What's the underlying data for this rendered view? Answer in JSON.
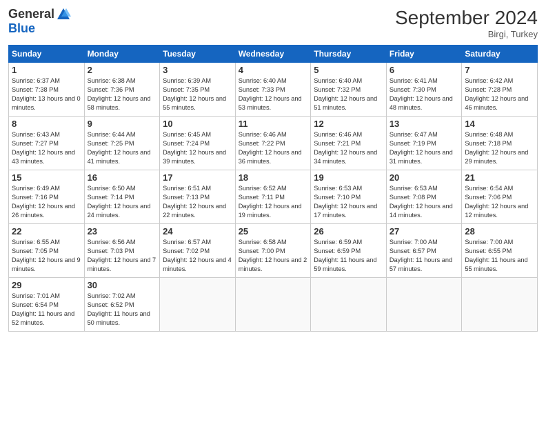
{
  "header": {
    "logo_line1": "General",
    "logo_line2": "Blue",
    "month": "September 2024",
    "location": "Birgi, Turkey"
  },
  "days_of_week": [
    "Sunday",
    "Monday",
    "Tuesday",
    "Wednesday",
    "Thursday",
    "Friday",
    "Saturday"
  ],
  "weeks": [
    [
      {
        "day": 1,
        "sunrise": "6:37 AM",
        "sunset": "7:38 PM",
        "daylight": "13 hours and 0 minutes."
      },
      {
        "day": 2,
        "sunrise": "6:38 AM",
        "sunset": "7:36 PM",
        "daylight": "12 hours and 58 minutes."
      },
      {
        "day": 3,
        "sunrise": "6:39 AM",
        "sunset": "7:35 PM",
        "daylight": "12 hours and 55 minutes."
      },
      {
        "day": 4,
        "sunrise": "6:40 AM",
        "sunset": "7:33 PM",
        "daylight": "12 hours and 53 minutes."
      },
      {
        "day": 5,
        "sunrise": "6:40 AM",
        "sunset": "7:32 PM",
        "daylight": "12 hours and 51 minutes."
      },
      {
        "day": 6,
        "sunrise": "6:41 AM",
        "sunset": "7:30 PM",
        "daylight": "12 hours and 48 minutes."
      },
      {
        "day": 7,
        "sunrise": "6:42 AM",
        "sunset": "7:28 PM",
        "daylight": "12 hours and 46 minutes."
      }
    ],
    [
      {
        "day": 8,
        "sunrise": "6:43 AM",
        "sunset": "7:27 PM",
        "daylight": "12 hours and 43 minutes."
      },
      {
        "day": 9,
        "sunrise": "6:44 AM",
        "sunset": "7:25 PM",
        "daylight": "12 hours and 41 minutes."
      },
      {
        "day": 10,
        "sunrise": "6:45 AM",
        "sunset": "7:24 PM",
        "daylight": "12 hours and 39 minutes."
      },
      {
        "day": 11,
        "sunrise": "6:46 AM",
        "sunset": "7:22 PM",
        "daylight": "12 hours and 36 minutes."
      },
      {
        "day": 12,
        "sunrise": "6:46 AM",
        "sunset": "7:21 PM",
        "daylight": "12 hours and 34 minutes."
      },
      {
        "day": 13,
        "sunrise": "6:47 AM",
        "sunset": "7:19 PM",
        "daylight": "12 hours and 31 minutes."
      },
      {
        "day": 14,
        "sunrise": "6:48 AM",
        "sunset": "7:18 PM",
        "daylight": "12 hours and 29 minutes."
      }
    ],
    [
      {
        "day": 15,
        "sunrise": "6:49 AM",
        "sunset": "7:16 PM",
        "daylight": "12 hours and 26 minutes."
      },
      {
        "day": 16,
        "sunrise": "6:50 AM",
        "sunset": "7:14 PM",
        "daylight": "12 hours and 24 minutes."
      },
      {
        "day": 17,
        "sunrise": "6:51 AM",
        "sunset": "7:13 PM",
        "daylight": "12 hours and 22 minutes."
      },
      {
        "day": 18,
        "sunrise": "6:52 AM",
        "sunset": "7:11 PM",
        "daylight": "12 hours and 19 minutes."
      },
      {
        "day": 19,
        "sunrise": "6:53 AM",
        "sunset": "7:10 PM",
        "daylight": "12 hours and 17 minutes."
      },
      {
        "day": 20,
        "sunrise": "6:53 AM",
        "sunset": "7:08 PM",
        "daylight": "12 hours and 14 minutes."
      },
      {
        "day": 21,
        "sunrise": "6:54 AM",
        "sunset": "7:06 PM",
        "daylight": "12 hours and 12 minutes."
      }
    ],
    [
      {
        "day": 22,
        "sunrise": "6:55 AM",
        "sunset": "7:05 PM",
        "daylight": "12 hours and 9 minutes."
      },
      {
        "day": 23,
        "sunrise": "6:56 AM",
        "sunset": "7:03 PM",
        "daylight": "12 hours and 7 minutes."
      },
      {
        "day": 24,
        "sunrise": "6:57 AM",
        "sunset": "7:02 PM",
        "daylight": "12 hours and 4 minutes."
      },
      {
        "day": 25,
        "sunrise": "6:58 AM",
        "sunset": "7:00 PM",
        "daylight": "12 hours and 2 minutes."
      },
      {
        "day": 26,
        "sunrise": "6:59 AM",
        "sunset": "6:59 PM",
        "daylight": "11 hours and 59 minutes."
      },
      {
        "day": 27,
        "sunrise": "7:00 AM",
        "sunset": "6:57 PM",
        "daylight": "11 hours and 57 minutes."
      },
      {
        "day": 28,
        "sunrise": "7:00 AM",
        "sunset": "6:55 PM",
        "daylight": "11 hours and 55 minutes."
      }
    ],
    [
      {
        "day": 29,
        "sunrise": "7:01 AM",
        "sunset": "6:54 PM",
        "daylight": "11 hours and 52 minutes."
      },
      {
        "day": 30,
        "sunrise": "7:02 AM",
        "sunset": "6:52 PM",
        "daylight": "11 hours and 50 minutes."
      },
      null,
      null,
      null,
      null,
      null
    ]
  ]
}
